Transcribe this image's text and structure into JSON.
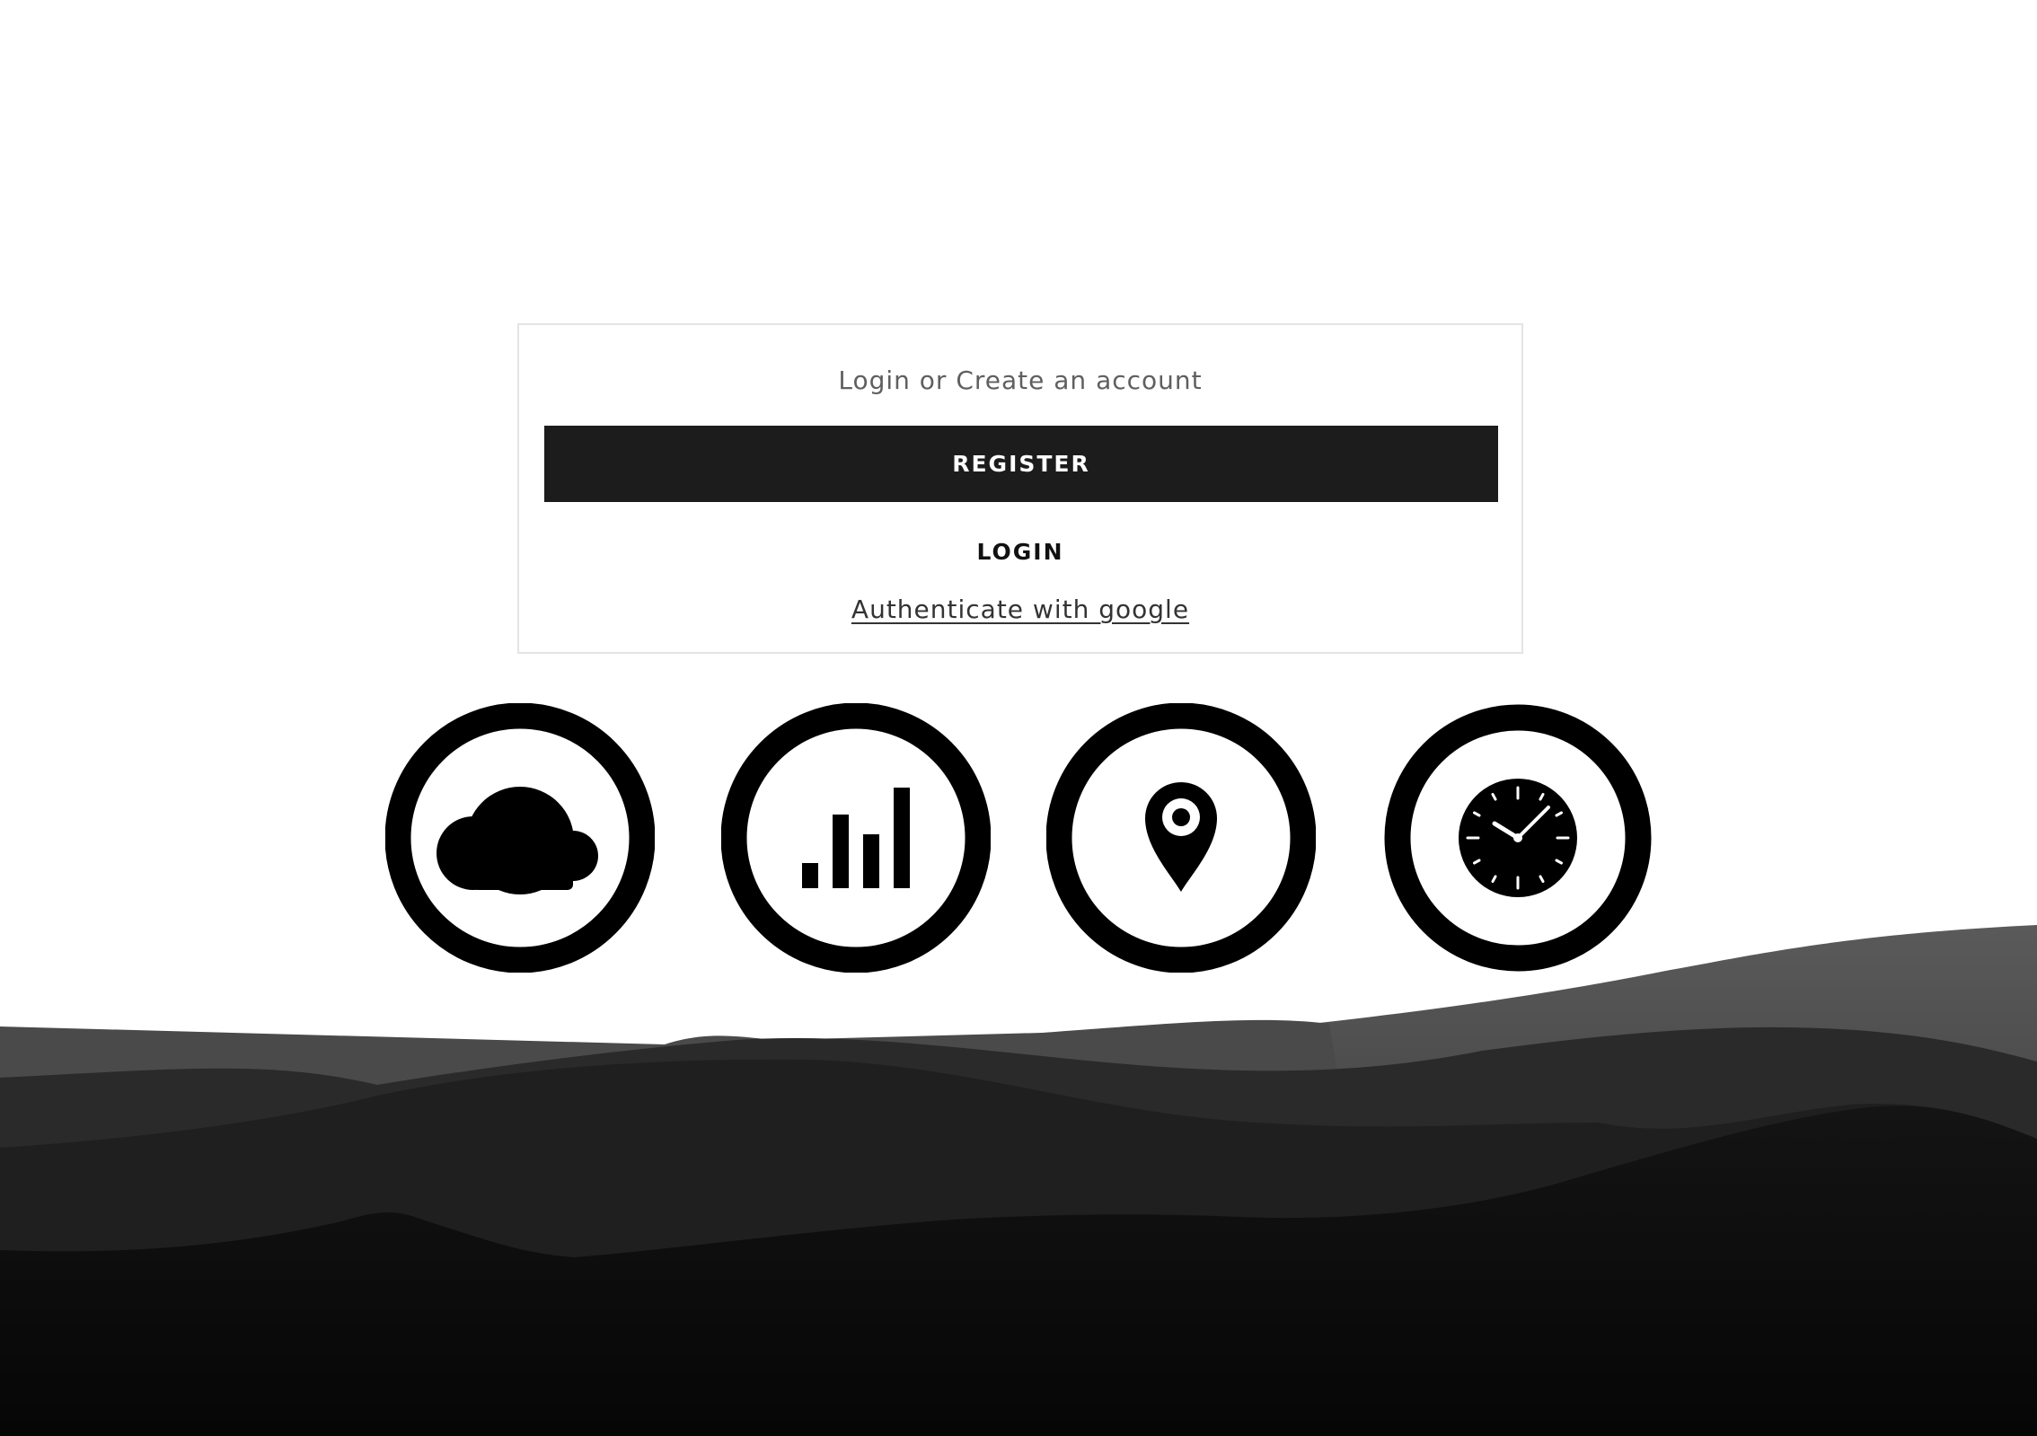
{
  "auth": {
    "heading": "Login or Create an account",
    "register_label": "REGISTER",
    "login_label": "LOGIN",
    "google_label": "Authenticate with google"
  },
  "features": [
    {
      "icon": "cloud-icon"
    },
    {
      "icon": "signal-bars-icon"
    },
    {
      "icon": "location-pin-icon"
    },
    {
      "icon": "clock-icon"
    }
  ],
  "colors": {
    "background": "#ffffff",
    "button_fill": "#1c1c1c",
    "button_text": "#ffffff",
    "icon": "#000000",
    "hills_far": "#4d4d4d",
    "hills_mid": "#2a2a2a",
    "hills_near": "#1e1e1e",
    "hills_front": "#0c0c0c"
  }
}
